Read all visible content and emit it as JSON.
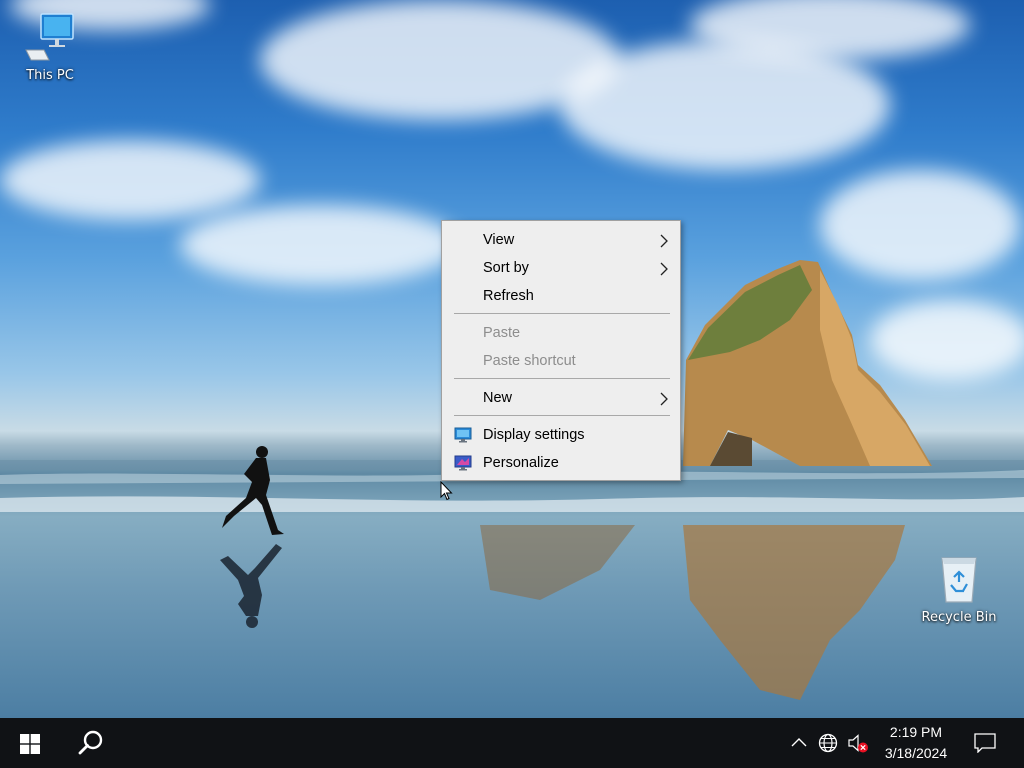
{
  "desktop": {
    "icons": [
      {
        "label": "This PC",
        "icon": "computer-icon"
      },
      {
        "label": "Recycle Bin",
        "icon": "recycle-bin-icon"
      }
    ]
  },
  "context_menu": {
    "items": [
      {
        "label": "View",
        "has_submenu": true,
        "enabled": true
      },
      {
        "label": "Sort by",
        "has_submenu": true,
        "enabled": true
      },
      {
        "label": "Refresh",
        "has_submenu": false,
        "enabled": true
      },
      {
        "label": "Paste",
        "has_submenu": false,
        "enabled": false
      },
      {
        "label": "Paste shortcut",
        "has_submenu": false,
        "enabled": false
      },
      {
        "label": "New",
        "has_submenu": true,
        "enabled": true
      },
      {
        "label": "Display settings",
        "icon": "display-settings-icon",
        "enabled": true
      },
      {
        "label": "Personalize",
        "icon": "personalize-icon",
        "enabled": true
      }
    ]
  },
  "taskbar": {
    "start_icon": "windows-logo-icon",
    "search_icon": "search-icon",
    "tray_icons": [
      "chevron-up-icon",
      "network-globe-icon",
      "volume-muted-icon"
    ],
    "clock": {
      "time": "2:19 PM",
      "date": "3/18/2024"
    },
    "notification_icon": "action-center-icon",
    "colors": {
      "background": "#101215",
      "text": "#ffffff"
    }
  }
}
